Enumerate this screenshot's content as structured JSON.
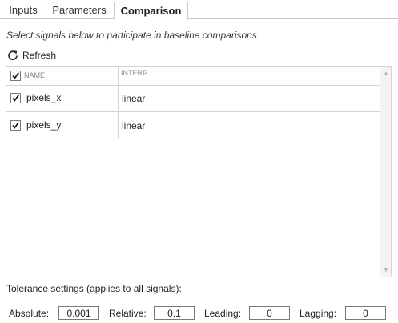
{
  "tabs": [
    {
      "label": "Inputs",
      "active": false
    },
    {
      "label": "Parameters",
      "active": false
    },
    {
      "label": "Comparison",
      "active": true
    }
  ],
  "subtitle": "Select signals below to participate in baseline comparisons",
  "refresh_label": "Refresh",
  "table": {
    "columns": [
      "NAME",
      "INTERP"
    ],
    "header_checked": true,
    "rows": [
      {
        "checked": true,
        "name": "pixels_x",
        "interp": "linear"
      },
      {
        "checked": true,
        "name": "pixels_y",
        "interp": "linear"
      }
    ]
  },
  "tolerance": {
    "label": "Tolerance settings (applies to all signals):",
    "absolute_label": "Absolute:",
    "absolute_value": "0.001",
    "relative_label": "Relative:",
    "relative_value": "0.1",
    "leading_label": "Leading:",
    "leading_value": "0",
    "lagging_label": "Lagging:",
    "lagging_value": "0"
  },
  "icons": {
    "refresh": "refresh-icon",
    "check": "checkmark-icon",
    "scroll_up": "arrow-up-icon",
    "scroll_down": "arrow-down-icon"
  }
}
